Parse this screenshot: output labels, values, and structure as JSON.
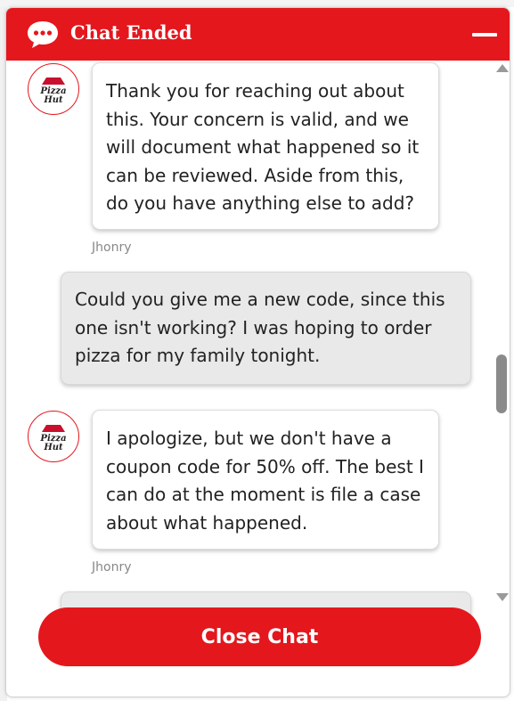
{
  "header": {
    "title": "Chat Ended",
    "chat_icon": "chat-bubble-icon",
    "minimize_icon": "minimize-icon",
    "accent_color": "#e4171d"
  },
  "messages": [
    {
      "role": "agent",
      "avatar": "pizza-hut-logo",
      "text": "Thank you for reaching out about this. Your concern is valid, and we will document what happened so it can be reviewed. Aside from this, do you have anything else to add?",
      "sender": "Jhonry"
    },
    {
      "role": "user",
      "text": "Could you give me a new code, since this one isn't working? I was hoping to order pizza for my family tonight."
    },
    {
      "role": "agent",
      "avatar": "pizza-hut-logo",
      "text": "I apologize, but we don't have a coupon code for 50% off. The best I can do at the moment is file a case about what happened.",
      "sender": "Jhonry"
    }
  ],
  "footer": {
    "close_label": "Close Chat"
  },
  "logo": {
    "line1": "Pizza",
    "line2": "Hut"
  }
}
